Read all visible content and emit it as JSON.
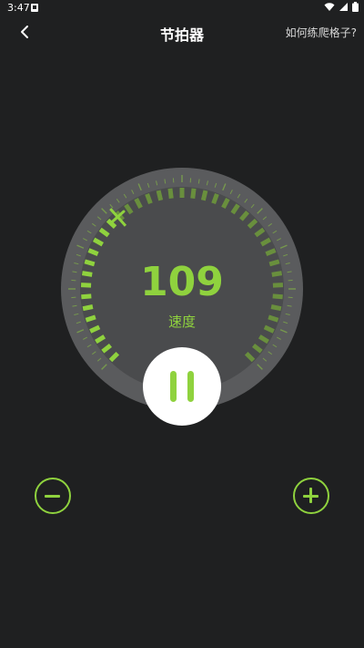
{
  "status_bar": {
    "time": "3:47",
    "icons": [
      "notification-icon",
      "wifi-icon",
      "cellular-icon",
      "battery-icon"
    ]
  },
  "header": {
    "back_icon": "chevron-left-icon",
    "title": "节拍器",
    "help_link": "如何练爬格子?"
  },
  "metronome": {
    "bpm": "109",
    "bpm_label": "速度",
    "dial_min": 40,
    "dial_max": 240,
    "state": "playing",
    "play_button_icon": "pause-icon"
  },
  "controls": {
    "decrease_icon": "minus-icon",
    "increase_icon": "plus-icon"
  },
  "colors": {
    "background": "#1f2021",
    "accent": "#8fd23e",
    "dial_face": "#4a4b4d",
    "dial_ring": "#5a5b5d",
    "button_face": "#ffffff"
  }
}
